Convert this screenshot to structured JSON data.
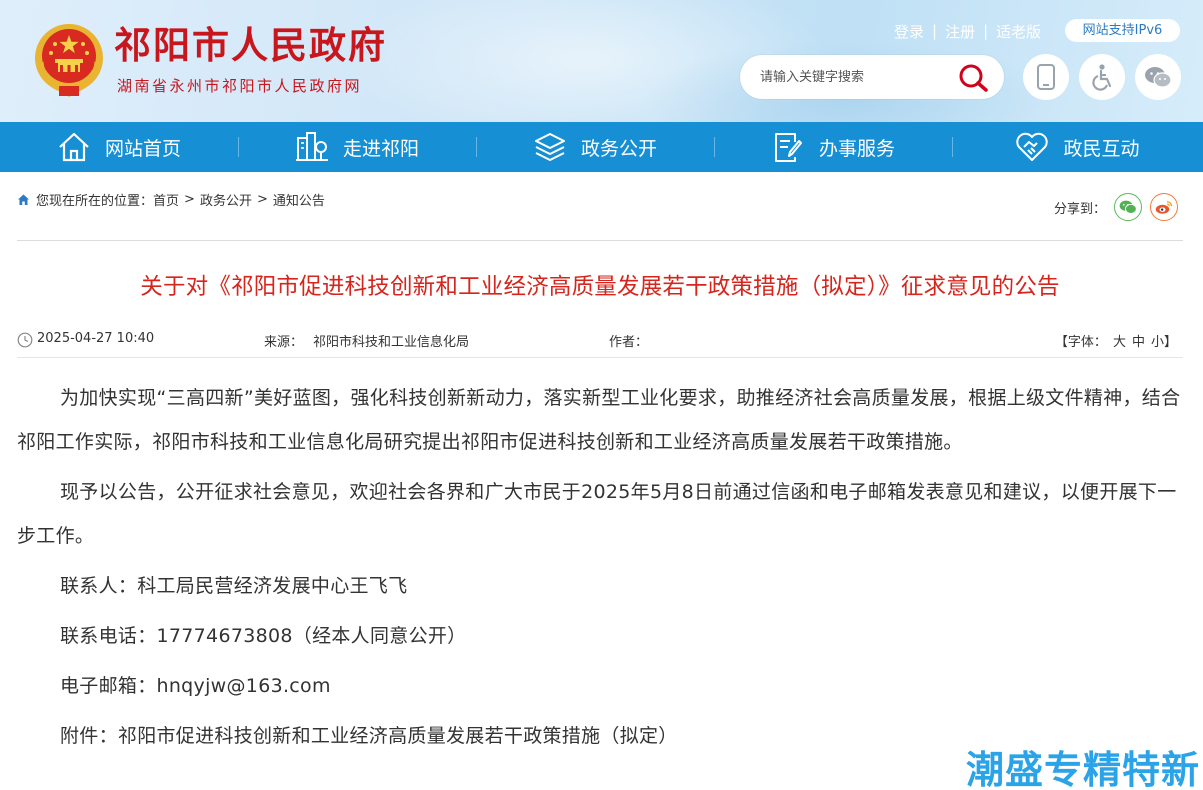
{
  "header": {
    "site_title": "祁阳市人民政府",
    "site_subtitle": "湖南省永州市祁阳市人民政府网",
    "links": {
      "login": "登录",
      "register": "注册",
      "elder": "适老版",
      "sep": "|"
    },
    "ipv6_badge": "网站支持IPv6",
    "search_placeholder": "请输入关键字搜索",
    "icons": [
      "mobile-icon",
      "accessibility-icon",
      "wechat-icon"
    ],
    "accent": "#c8161d"
  },
  "nav": {
    "items": [
      {
        "label": "网站首页",
        "icon": "home-icon"
      },
      {
        "label": "走进祁阳",
        "icon": "city-icon"
      },
      {
        "label": "政务公开",
        "icon": "layers-icon"
      },
      {
        "label": "办事服务",
        "icon": "document-edit-icon"
      },
      {
        "label": "政民互动",
        "icon": "handshake-heart-icon"
      }
    ],
    "color": "#168fd5"
  },
  "breadcrumb": {
    "prefix": "您现在所在的位置：",
    "items": [
      "首页",
      "政务公开",
      "通知公告"
    ],
    "sep": ">"
  },
  "share": {
    "label": "分享到："
  },
  "article": {
    "title": "关于对《祁阳市促进科技创新和工业经济高质量发展若干政策措施（拟定）》征求意见的公告",
    "date": "2025-04-27 10:40",
    "source_label": "来源：",
    "source_value": "祁阳市科技和工业信息化局",
    "author_label": "作者：",
    "font_label": "【字体：",
    "font_options": [
      "大",
      "中",
      "小"
    ],
    "font_close": "】",
    "paragraphs": [
      "为加快实现“三高四新”美好蓝图，强化科技创新新动力，落实新型工业化要求，助推经济社会高质量发展，根据上级文件精神，结合祁阳工作实际，祁阳市科技和工业信息化局研究提出祁阳市促进科技创新和工业经济高质量发展若干政策措施。",
      "现予以公告，公开征求社会意见，欢迎社会各界和广大市民于2025年5月8日前通过信函和电子邮箱发表意见和建议，以便开展下一步工作。"
    ],
    "contact": "联系人：科工局民营经济发展中心王飞飞",
    "phone": "联系电话：17774673808（经本人同意公开）",
    "email": "电子邮箱：hnqyjw@163.com",
    "attachment": "附件：祁阳市促进科技创新和工业经济高质量发展若干政策措施（拟定）",
    "title_color": "#d6251c"
  },
  "watermark": "潮盛专精特新"
}
